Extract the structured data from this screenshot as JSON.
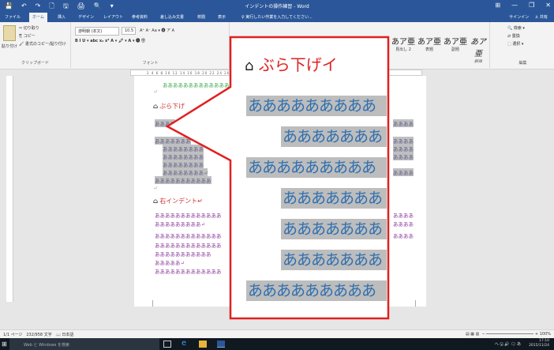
{
  "window": {
    "title": "インデントの操作練習 - Word",
    "controls": [
      "⊞",
      "—",
      "❐",
      "✕"
    ]
  },
  "qat": [
    "💾",
    "↶",
    "↷",
    "🗋",
    "🖫",
    "🖨",
    "🔍",
    "▾"
  ],
  "tabs": [
    "ファイル",
    "ホーム",
    "挿入",
    "デザイン",
    "レイアウト",
    "参考資料",
    "差し込み文書",
    "校閲",
    "表示"
  ],
  "tell_me": "♀ 実行したい作業を入力してください...",
  "signin": "サインイン",
  "share": "共有",
  "ribbon": {
    "clipboard": {
      "paste": "貼り付け",
      "cut": "✂ 切り取り",
      "copy": "⎘ コピー",
      "format_painter": "🖌 書式のコピー/貼り付け",
      "label": "クリップボード"
    },
    "font": {
      "name": "游明朝 (本文)",
      "size": "10.5",
      "row1_extra": "A⁺ A⁻ Aa ▾ 🅐 ア A",
      "row2": "B  I  U ▾ abc  x₂  x²  A ▾ 🖍 ▾ A ▾ 🅐 ㊉",
      "label": "フォント"
    },
    "styles": {
      "label": "スタイル",
      "items": [
        {
          "sample": "あア亜",
          "name": "見出し 2"
        },
        {
          "sample": "あア亜",
          "name": "表題"
        },
        {
          "sample": "あア亜",
          "name": "副題"
        },
        {
          "sample": "あア亜",
          "name": "斜体"
        }
      ]
    },
    "editing": {
      "search": "🔍 検索 ▾",
      "replace": "⇄ 置換",
      "select": "⬚ 選択 ▾",
      "label": "編集"
    }
  },
  "ruler": {
    "ticks": "2  4  6  8  10  12  14  16  18  20  22  24  26  28  30  32  34  36  38  40  42  44  46  48  50  52"
  },
  "document": {
    "line_green": "あああああああああああああ",
    "return_mark": "↵",
    "hanging_heading": "ぶら下げ",
    "hl_line1": "ああああ",
    "hl_block_first": "あああああああ",
    "hl_block_indented": "ああああああああ",
    "hl_block_short": "ああああああああ↵",
    "hl_block_last": "あああああああああああ",
    "right_hl": "ああああ",
    "right_heading": "右インデント↵",
    "purple1": "あああああああああああああ",
    "purple2": "あああああああああ↵",
    "purple3": "あああああああああああああ",
    "purple4": "あああああああああああああ",
    "purple5": "あああああああああああ",
    "purple6": "あああああ↵",
    "purple7": "あああああああああああああ",
    "purple_tail": "ああああ"
  },
  "zoom": {
    "title": "ぶら下げイ",
    "rows": [
      "あああああああああ",
      "あああああああ",
      "あああああああああ",
      "あああああああ",
      "あああああああ",
      "あああああああ",
      "あああああああああ"
    ]
  },
  "colors": {
    "titlebar": "#2b579a",
    "callout_border": "#e02020",
    "highlight": "#bdbdbd",
    "zoom_text": "#2e6fb0"
  },
  "status": {
    "page": "1/1 ページ",
    "words": "232/958 文字",
    "lang": "日本語",
    "zoom": "100%"
  },
  "taskbar": {
    "search": "Web と Windows を検索",
    "time": "17:10",
    "date": "2015/11/24",
    "tray": "へ 🖫 🔊 🗨 あ"
  }
}
